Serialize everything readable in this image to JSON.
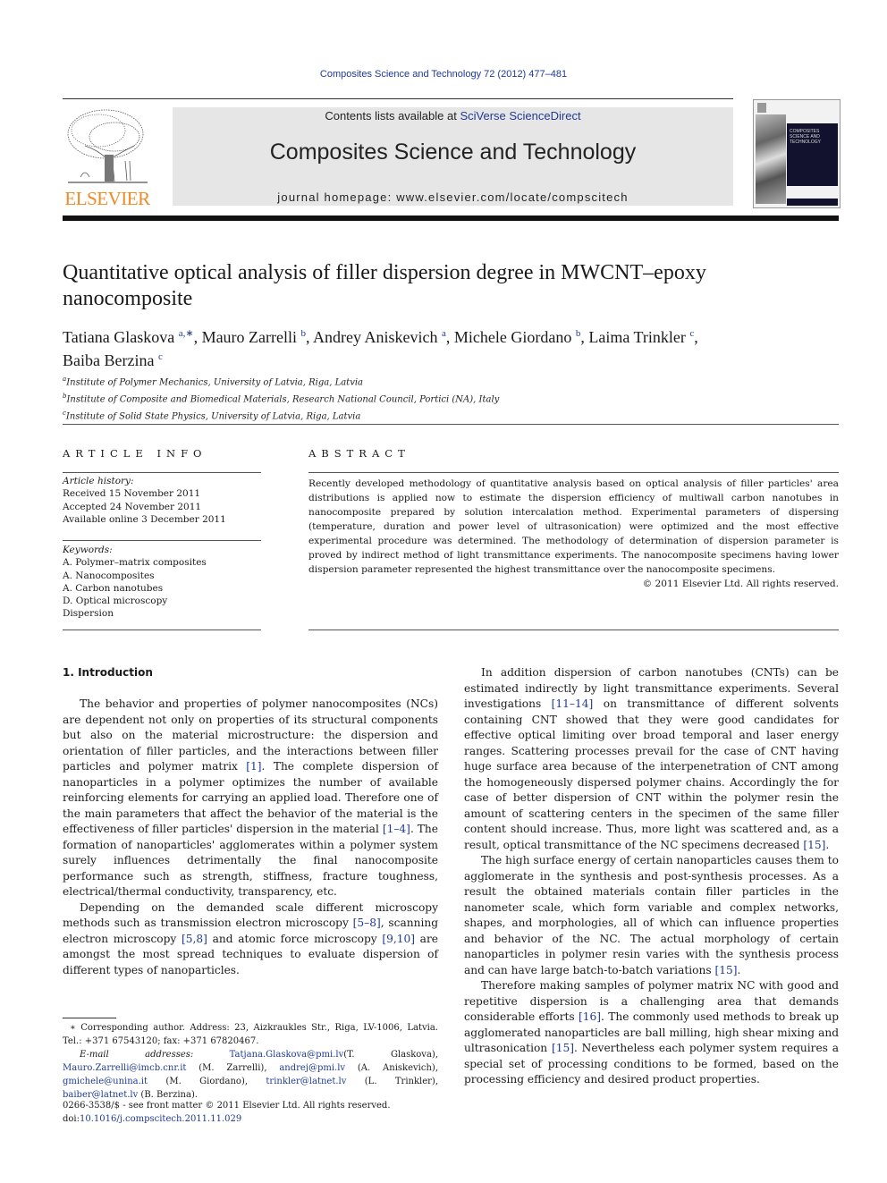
{
  "header": {
    "citation": "Composites Science and Technology 72 (2012) 477–481",
    "publisher_wordmark": "ELSEVIER",
    "contents_prefix": "Contents lists available at ",
    "contents_link": "SciVerse ScienceDirect",
    "journal_title": "Composites Science and Technology",
    "homepage_prefix": "journal homepage: ",
    "homepage_url": "www.elsevier.com/locate/compscitech",
    "cover_title": "COMPOSITES SCIENCE AND TECHNOLOGY",
    "colors": {
      "elsevier_orange": "#f08a24",
      "link_blue": "#1f3a93",
      "masthead_gray": "#e6e6e6",
      "cover_navy": "#12122e"
    }
  },
  "article": {
    "title": "Quantitative optical analysis of filler dispersion degree in MWCNT–epoxy nanocomposite",
    "authors": [
      {
        "name": "Tatiana Glaskova",
        "sup": "a,∗",
        "sep": ", "
      },
      {
        "name": "Mauro Zarrelli",
        "sup": "b",
        "sep": ", "
      },
      {
        "name": "Andrey Aniskevich",
        "sup": "a",
        "sep": ", "
      },
      {
        "name": "Michele Giordano",
        "sup": "b",
        "sep": ", "
      },
      {
        "name": "Laima Trinkler",
        "sup": "c",
        "sep": ", "
      },
      {
        "name": "Baiba Berzina",
        "sup": "c",
        "sep": ""
      }
    ],
    "affiliations": [
      {
        "key": "a",
        "text": "Institute of Polymer Mechanics, University of Latvia, Riga, Latvia"
      },
      {
        "key": "b",
        "text": "Institute of Composite and Biomedical Materials, Research National Council, Portici (NA), Italy"
      },
      {
        "key": "c",
        "text": "Institute of Solid State Physics, University of Latvia, Riga, Latvia"
      }
    ]
  },
  "article_info": {
    "heading": "ARTICLE INFO",
    "history_label": "Article history:",
    "history": [
      "Received 15 November 2011",
      "Accepted 24 November 2011",
      "Available online 3 December 2011"
    ],
    "keywords_label": "Keywords:",
    "keywords": [
      "A. Polymer–matrix composites",
      "A. Nanocomposites",
      "A. Carbon nanotubes",
      "D. Optical microscopy",
      "Dispersion"
    ]
  },
  "abstract": {
    "heading": "ABSTRACT",
    "text": "Recently developed methodology of quantitative analysis based on optical analysis of filler particles' area distributions is applied now to estimate the dispersion efficiency of multiwall carbon nanotubes in nanocomposite prepared by solution intercalation method. Experimental parameters of dispersing (temperature, duration and power level of ultrasonication) were optimized and the most effective experimental procedure was determined. The methodology of determination of dispersion parameter is proved by indirect method of light transmittance experiments. The nanocomposite specimens having lower dispersion parameter represented the highest transmittance over the nanocomposite specimens.",
    "copyright": "© 2011 Elsevier Ltd. All rights reserved."
  },
  "body": {
    "section_heading": "1. Introduction",
    "left_paragraphs": [
      [
        {
          "t": "The behavior and properties of polymer nanocomposites (NCs) are dependent not only on properties of its structural components but also on the material microstructure: the dispersion and orientation of filler particles, and the interactions between filler particles and polymer matrix "
        },
        {
          "ref": "[1]"
        },
        {
          "t": ". The complete dispersion of nanoparticles in a polymer optimizes the number of available reinforcing elements for carrying an applied load. Therefore one of the main parameters that affect the behavior of the material is the effectiveness of filler particles' dispersion in the material "
        },
        {
          "ref": "[1–4]"
        },
        {
          "t": ". The formation of nanoparticles' agglomerates within a polymer system surely influences detrimentally the final nanocomposite performance such as strength, stiffness, fracture toughness, electrical/thermal conductivity, transparency, etc."
        }
      ],
      [
        {
          "t": "Depending on the demanded scale different microscopy methods such as transmission electron microscopy "
        },
        {
          "ref": "[5–8]"
        },
        {
          "t": ", scanning electron microscopy "
        },
        {
          "ref": "[5,8]"
        },
        {
          "t": " and atomic force microscopy "
        },
        {
          "ref": "[9,10]"
        },
        {
          "t": " are amongst the most spread techniques to evaluate dispersion of different types of nanoparticles."
        }
      ]
    ],
    "right_paragraphs": [
      [
        {
          "t": "In addition dispersion of carbon nanotubes (CNTs) can be estimated indirectly by light transmittance experiments. Several investigations "
        },
        {
          "ref": "[11–14]"
        },
        {
          "t": " on transmittance of different solvents containing CNT showed that they were good candidates for effective optical limiting over broad temporal and laser energy ranges. Scattering processes prevail for the case of CNT having huge surface area because of the interpenetration of CNT among the homogeneously dispersed polymer chains. Accordingly the for case of better dispersion of CNT within the polymer resin the amount of scattering centers in the specimen of the same filler content should increase. Thus, more light was scattered and, as a result, optical transmittance of the NC specimens decreased "
        },
        {
          "ref": "[15]"
        },
        {
          "t": "."
        }
      ],
      [
        {
          "t": "The high surface energy of certain nanoparticles causes them to agglomerate in the synthesis and post-synthesis processes. As a result the obtained materials contain filler particles in the nanometer scale, which form variable and complex networks, shapes, and morphologies, all of which can influence properties and behavior of the NC. The actual morphology of certain nanoparticles in polymer resin varies with the synthesis process and can have large batch-to-batch variations "
        },
        {
          "ref": "[15]"
        },
        {
          "t": "."
        }
      ],
      [
        {
          "t": "Therefore making samples of polymer matrix NC with good and repetitive dispersion is a challenging area that demands considerable efforts "
        },
        {
          "ref": "[16]"
        },
        {
          "t": ". The commonly used methods to break up agglomerated nanoparticles are ball milling, high shear mixing and ultrasonication "
        },
        {
          "ref": "[15]"
        },
        {
          "t": ". Nevertheless each polymer system requires a special set of processing conditions to be formed, based on the processing efficiency and desired product properties."
        }
      ]
    ]
  },
  "footnotes": {
    "corresponding": "∗ Corresponding author. Address: 23, Aizkraukles Str., Riga, LV-1006, Latvia. Tel.: +371 67543120; fax: +371 67820467.",
    "email_label": "E-mail addresses: ",
    "emails": [
      {
        "addr": "Tatjana.Glaskova@pmi.lv",
        "who": "(T. Glaskova), "
      },
      {
        "addr": "Mauro.Zarrelli@imcb.cnr.it",
        "who": " (M. Zarrelli), "
      },
      {
        "addr": "andrej@pmi.lv",
        "who": " (A. Aniskevich), "
      },
      {
        "addr": "gmichele@unina.it",
        "who": " (M. Giordano), "
      },
      {
        "addr": "trinkler@latnet.lv",
        "who": " (L. Trinkler), "
      },
      {
        "addr": "baiber@latnet.lv",
        "who": " (B. Berzina)."
      }
    ],
    "front_matter": "0266-3538/$ - see front matter © 2011 Elsevier Ltd. All rights reserved.",
    "doi_prefix": "doi:",
    "doi": "10.1016/j.compscitech.2011.11.029"
  }
}
